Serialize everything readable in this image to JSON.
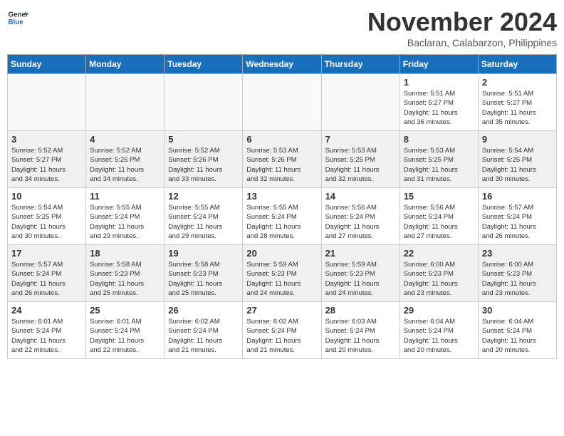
{
  "header": {
    "logo_line1": "General",
    "logo_line2": "Blue",
    "month": "November 2024",
    "location": "Baclaran, Calabarzon, Philippines"
  },
  "weekdays": [
    "Sunday",
    "Monday",
    "Tuesday",
    "Wednesday",
    "Thursday",
    "Friday",
    "Saturday"
  ],
  "weeks": [
    [
      {
        "day": "",
        "info": ""
      },
      {
        "day": "",
        "info": ""
      },
      {
        "day": "",
        "info": ""
      },
      {
        "day": "",
        "info": ""
      },
      {
        "day": "",
        "info": ""
      },
      {
        "day": "1",
        "info": "Sunrise: 5:51 AM\nSunset: 5:27 PM\nDaylight: 11 hours\nand 36 minutes."
      },
      {
        "day": "2",
        "info": "Sunrise: 5:51 AM\nSunset: 5:27 PM\nDaylight: 11 hours\nand 35 minutes."
      }
    ],
    [
      {
        "day": "3",
        "info": "Sunrise: 5:52 AM\nSunset: 5:27 PM\nDaylight: 11 hours\nand 34 minutes."
      },
      {
        "day": "4",
        "info": "Sunrise: 5:52 AM\nSunset: 5:26 PM\nDaylight: 11 hours\nand 34 minutes."
      },
      {
        "day": "5",
        "info": "Sunrise: 5:52 AM\nSunset: 5:26 PM\nDaylight: 11 hours\nand 33 minutes."
      },
      {
        "day": "6",
        "info": "Sunrise: 5:53 AM\nSunset: 5:26 PM\nDaylight: 11 hours\nand 32 minutes."
      },
      {
        "day": "7",
        "info": "Sunrise: 5:53 AM\nSunset: 5:25 PM\nDaylight: 11 hours\nand 32 minutes."
      },
      {
        "day": "8",
        "info": "Sunrise: 5:53 AM\nSunset: 5:25 PM\nDaylight: 11 hours\nand 31 minutes."
      },
      {
        "day": "9",
        "info": "Sunrise: 5:54 AM\nSunset: 5:25 PM\nDaylight: 11 hours\nand 30 minutes."
      }
    ],
    [
      {
        "day": "10",
        "info": "Sunrise: 5:54 AM\nSunset: 5:25 PM\nDaylight: 11 hours\nand 30 minutes."
      },
      {
        "day": "11",
        "info": "Sunrise: 5:55 AM\nSunset: 5:24 PM\nDaylight: 11 hours\nand 29 minutes."
      },
      {
        "day": "12",
        "info": "Sunrise: 5:55 AM\nSunset: 5:24 PM\nDaylight: 11 hours\nand 29 minutes."
      },
      {
        "day": "13",
        "info": "Sunrise: 5:55 AM\nSunset: 5:24 PM\nDaylight: 11 hours\nand 28 minutes."
      },
      {
        "day": "14",
        "info": "Sunrise: 5:56 AM\nSunset: 5:24 PM\nDaylight: 11 hours\nand 27 minutes."
      },
      {
        "day": "15",
        "info": "Sunrise: 5:56 AM\nSunset: 5:24 PM\nDaylight: 11 hours\nand 27 minutes."
      },
      {
        "day": "16",
        "info": "Sunrise: 5:57 AM\nSunset: 5:24 PM\nDaylight: 11 hours\nand 26 minutes."
      }
    ],
    [
      {
        "day": "17",
        "info": "Sunrise: 5:57 AM\nSunset: 5:24 PM\nDaylight: 11 hours\nand 26 minutes."
      },
      {
        "day": "18",
        "info": "Sunrise: 5:58 AM\nSunset: 5:23 PM\nDaylight: 11 hours\nand 25 minutes."
      },
      {
        "day": "19",
        "info": "Sunrise: 5:58 AM\nSunset: 5:23 PM\nDaylight: 11 hours\nand 25 minutes."
      },
      {
        "day": "20",
        "info": "Sunrise: 5:59 AM\nSunset: 5:23 PM\nDaylight: 11 hours\nand 24 minutes."
      },
      {
        "day": "21",
        "info": "Sunrise: 5:59 AM\nSunset: 5:23 PM\nDaylight: 11 hours\nand 24 minutes."
      },
      {
        "day": "22",
        "info": "Sunrise: 6:00 AM\nSunset: 5:23 PM\nDaylight: 11 hours\nand 23 minutes."
      },
      {
        "day": "23",
        "info": "Sunrise: 6:00 AM\nSunset: 5:23 PM\nDaylight: 11 hours\nand 23 minutes."
      }
    ],
    [
      {
        "day": "24",
        "info": "Sunrise: 6:01 AM\nSunset: 5:24 PM\nDaylight: 11 hours\nand 22 minutes."
      },
      {
        "day": "25",
        "info": "Sunrise: 6:01 AM\nSunset: 5:24 PM\nDaylight: 11 hours\nand 22 minutes."
      },
      {
        "day": "26",
        "info": "Sunrise: 6:02 AM\nSunset: 5:24 PM\nDaylight: 11 hours\nand 21 minutes."
      },
      {
        "day": "27",
        "info": "Sunrise: 6:02 AM\nSunset: 5:24 PM\nDaylight: 11 hours\nand 21 minutes."
      },
      {
        "day": "28",
        "info": "Sunrise: 6:03 AM\nSunset: 5:24 PM\nDaylight: 11 hours\nand 20 minutes."
      },
      {
        "day": "29",
        "info": "Sunrise: 6:04 AM\nSunset: 5:24 PM\nDaylight: 11 hours\nand 20 minutes."
      },
      {
        "day": "30",
        "info": "Sunrise: 6:04 AM\nSunset: 5:24 PM\nDaylight: 11 hours\nand 20 minutes."
      }
    ]
  ]
}
